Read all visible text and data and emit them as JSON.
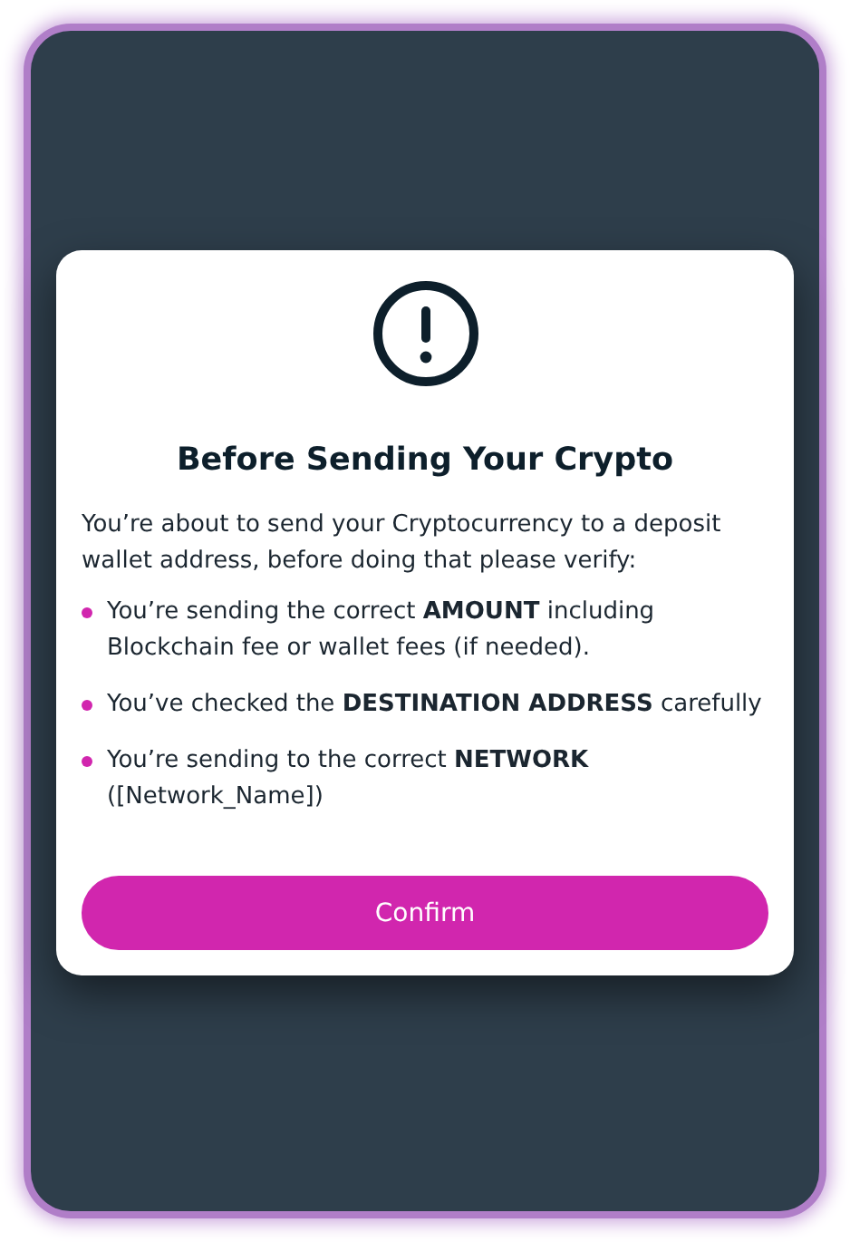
{
  "dialog": {
    "title": "Before Sending Your Crypto",
    "intro": "You’re about to send your Cryptocurrency to a deposit wallet address, before doing that please verify:",
    "checklist": [
      "You’re sending the correct **AMOUNT** including Blockchain fee or wallet fees (if needed).",
      "You’ve checked the **DESTINATION ADDRESS** carefully",
      "You’re sending to the correct **NETWORK** ([Network_Name])"
    ],
    "button": "Confirm"
  }
}
